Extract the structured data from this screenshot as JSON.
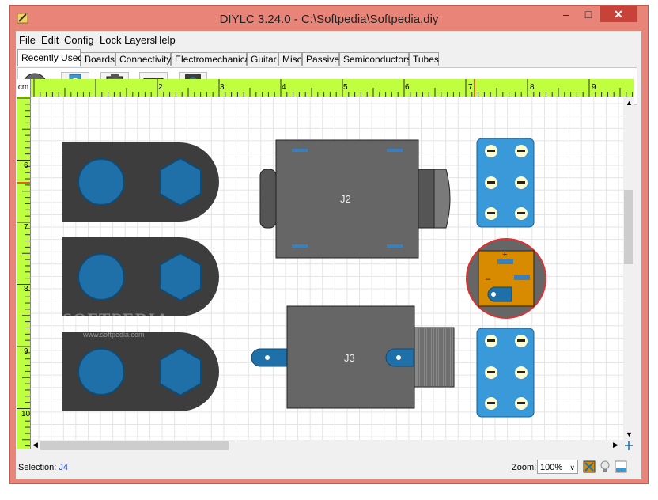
{
  "window": {
    "title": "DIYLC 3.24.0 - C:\\Softpedia\\Softpedia.diy",
    "minimize": "–",
    "maximize": "□",
    "close": "✕"
  },
  "menu": [
    "File",
    "Edit",
    "Config",
    "Lock Layers",
    "Help"
  ],
  "tabs": [
    "Recently Used",
    "Boards",
    "Connectivity",
    "Electromechanical",
    "Guitar",
    "Misc",
    "Passive",
    "Semiconductors",
    "Tubes"
  ],
  "active_tab": "Recently Used",
  "toolbar_icons": [
    "dc-jack-icon",
    "terminal-strip-icon",
    "jack-icon",
    "switch-icon",
    "potentiometer-icon"
  ],
  "ruler": {
    "unit": "cm",
    "top_labels": [
      "2",
      "3",
      "4",
      "5",
      "6",
      "7",
      "8",
      "9"
    ],
    "left_labels": [
      "6",
      "7",
      "8",
      "9",
      "10"
    ]
  },
  "canvas": {
    "components": [
      {
        "label": "J2"
      },
      {
        "label": "J3"
      }
    ],
    "dc_jack_marks": {
      "plus": "+",
      "minus": "–"
    },
    "watermark": "SOFTPEDIA",
    "watermark_url": "www.softpedia.com"
  },
  "status": {
    "selection_label": "Selection:",
    "selection_value": "J4",
    "zoom_label": "Zoom:",
    "zoom_value": "100%"
  },
  "colors": {
    "window_frame": "#e88478",
    "ruler": "#bfff3f",
    "component_blue": "#3a9ad9",
    "component_dark": "#3d3d3d",
    "component_gray": "#666666",
    "dc_jack_orange": "#d98b00"
  }
}
